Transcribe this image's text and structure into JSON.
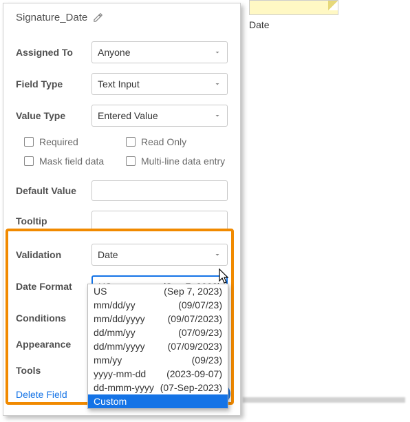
{
  "field_name": "Signature_Date",
  "side_label": "Date",
  "labels": {
    "assigned_to": "Assigned To",
    "field_type": "Field Type",
    "value_type": "Value Type",
    "required": "Required",
    "read_only": "Read Only",
    "mask": "Mask field data",
    "multiline": "Multi-line data entry",
    "default_value": "Default Value",
    "tooltip": "Tooltip",
    "validation": "Validation",
    "date_format": "Date Format",
    "conditions": "Conditions",
    "appearance": "Appearance",
    "tools": "Tools",
    "delete": "Delete Field"
  },
  "values": {
    "assigned_to": "Anyone",
    "field_type": "Text Input",
    "value_type": "Entered Value",
    "validation": "Date",
    "date_format_left": "US",
    "date_format_right": "(Sep 7, 2023)"
  },
  "dropdown": [
    {
      "fmt": "US",
      "ex": "(Sep 7, 2023)"
    },
    {
      "fmt": "mm/dd/yy",
      "ex": "(09/07/23)"
    },
    {
      "fmt": "mm/dd/yyyy",
      "ex": "(09/07/2023)"
    },
    {
      "fmt": "dd/mm/yy",
      "ex": "(07/09/23)"
    },
    {
      "fmt": "dd/mm/yyyy",
      "ex": "(07/09/2023)"
    },
    {
      "fmt": "mm/yy",
      "ex": "(09/23)"
    },
    {
      "fmt": "yyyy-mm-dd",
      "ex": "(2023-09-07)"
    },
    {
      "fmt": "dd-mmm-yyyy",
      "ex": "(07-Sep-2023)"
    },
    {
      "fmt": "Custom",
      "ex": ""
    }
  ]
}
